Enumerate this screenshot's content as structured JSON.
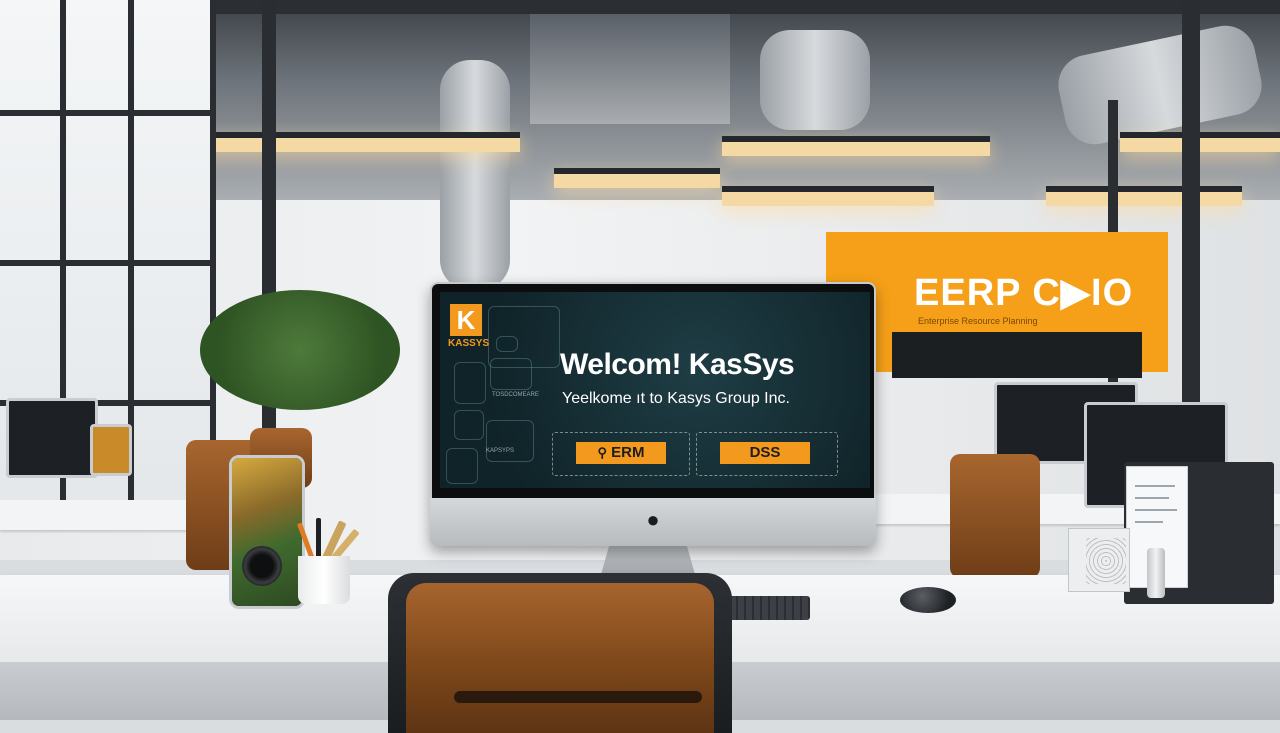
{
  "screen": {
    "logo_letter": "K",
    "logo_text": "KASSYS",
    "headline": "Welcom! KasSys",
    "tagline": "Yeelkome ıt to Kasys Group Inc.",
    "buttons": [
      {
        "label": "ERM",
        "icon": "search-icon"
      },
      {
        "label": "DSS"
      }
    ],
    "circuit_labels": [
      "TOSDCOMEARE",
      "KAPSYPS"
    ]
  },
  "wall_sign": {
    "text": "EERP C▶IO",
    "subtext": "Enterprise Resource Planning"
  },
  "colors": {
    "accent": "#f39a1e",
    "screen_bg": "#0f2328",
    "sign_bg": "#f5a018"
  }
}
